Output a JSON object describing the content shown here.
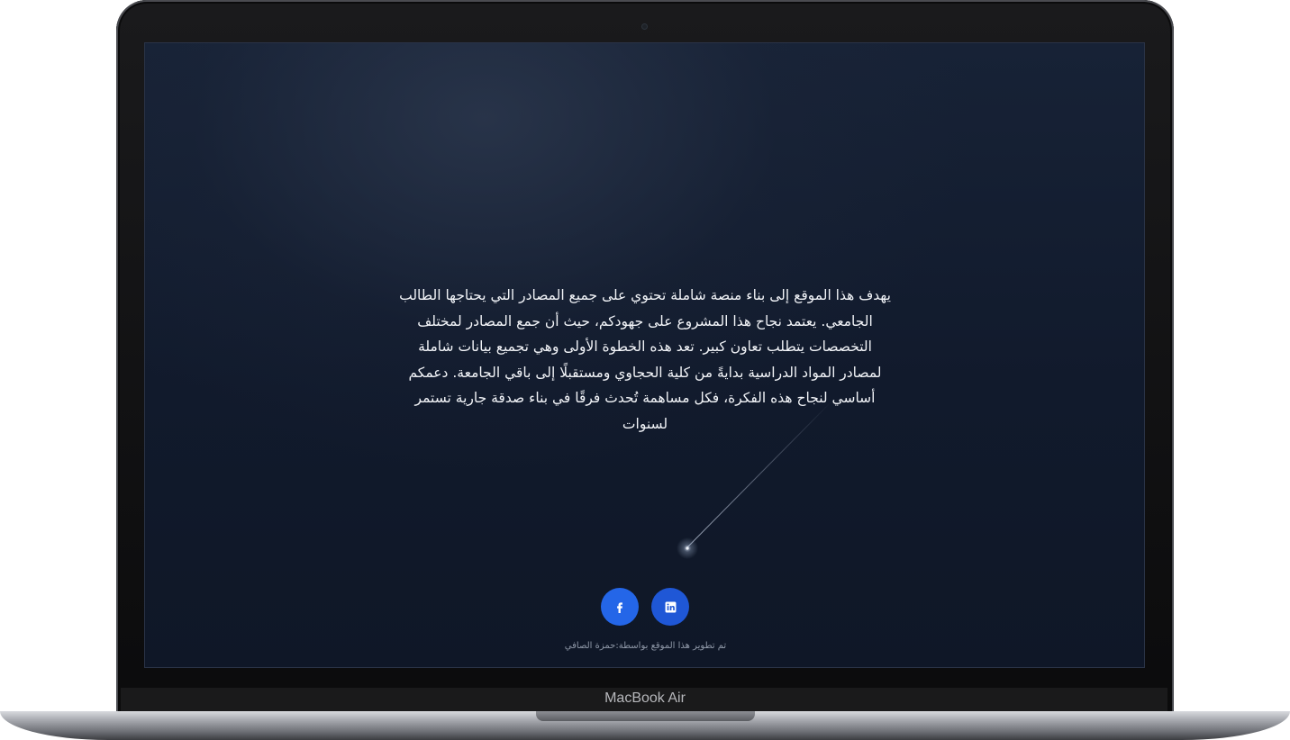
{
  "device": {
    "model_label": "MacBook Air"
  },
  "page": {
    "about_text": "يهدف هذا الموقع إلى بناء منصة شاملة تحتوي على جميع المصادر التي يحتاجها الطالب الجامعي. يعتمد نجاح هذا المشروع على جهودكم، حيث أن جمع المصادر لمختلف التخصصات يتطلب تعاون كبير. تعد هذه الخطوة الأولى وهي تجميع بيانات شاملة لمصادر المواد الدراسية بدايةً من كلية الحجاوي ومستقبلًا إلى باقي الجامعة. دعمكم أساسي لنجاح هذه الفكرة، فكل مساهمة تُحدث فرقًا في بناء صدقة جارية تستمر لسنوات",
    "social": [
      {
        "name": "facebook",
        "icon": "facebook-icon",
        "color": "#2466e8"
      },
      {
        "name": "linkedin",
        "icon": "linkedin-icon",
        "color": "#1f57d6"
      }
    ],
    "credit": "تم تطوير هذا الموقع بواسطة:حمزة الصافي"
  },
  "colors": {
    "background": "#111a2c",
    "text": "#f2f4f8",
    "accent": "#2466e8"
  }
}
